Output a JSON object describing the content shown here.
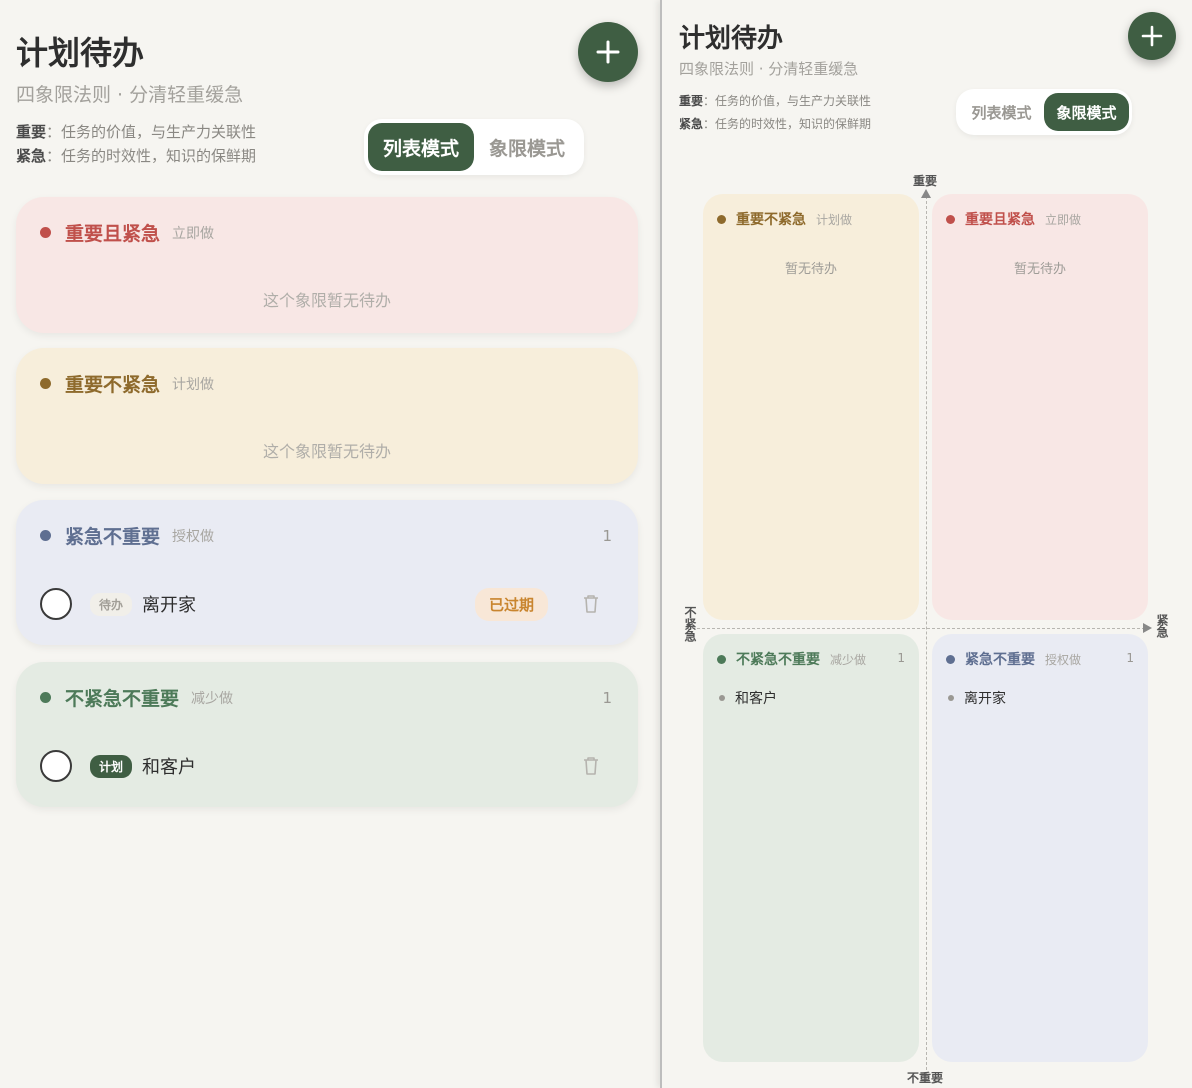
{
  "left": {
    "title": "计划待办",
    "subtitle": "四象限法则 · 分清轻重缓急",
    "defs": [
      {
        "term": "重要",
        "desc": "：任务的价值，与生产力关联性"
      },
      {
        "term": "紧急",
        "desc": "：任务的时效性，知识的保鲜期"
      }
    ],
    "toggle": [
      "列表模式",
      "象限模式"
    ],
    "active_mode": "列表模式",
    "quadrants": [
      {
        "name": "重要且紧急",
        "sub": "立即做",
        "color": "#c0504b",
        "bg": "#f8e7e5",
        "empty_text": "这个象限暂无待办",
        "count": "",
        "tasks": []
      },
      {
        "name": "重要不紧急",
        "sub": "计划做",
        "color": "#8e6a2c",
        "bg": "#f7eedb",
        "empty_text": "这个象限暂无待办",
        "count": "",
        "tasks": []
      },
      {
        "name": "紧急不重要",
        "sub": "授权做",
        "color": "#5f6f91",
        "bg": "#e9ebf3",
        "count": "1",
        "tasks": [
          {
            "tag": "待办",
            "text": "离开家",
            "overdue": "已过期"
          }
        ]
      },
      {
        "name": "不紧急不重要",
        "sub": "减少做",
        "color": "#4d7a59",
        "bg": "#e4ebe3",
        "count": "1",
        "tasks": [
          {
            "tag": "计划",
            "text": "和客户"
          }
        ]
      }
    ]
  },
  "right": {
    "title": "计划待办",
    "subtitle": "四象限法则 · 分清轻重缓急",
    "defs": [
      {
        "term": "重要",
        "desc": "：任务的价值，与生产力关联性"
      },
      {
        "term": "紧急",
        "desc": "：任务的时效性，知识的保鲜期"
      }
    ],
    "toggle": [
      "列表模式",
      "象限模式"
    ],
    "active_mode": "象限模式",
    "axis": {
      "top": "重要",
      "bottom": "不重要",
      "left": "不紧急",
      "right": "紧急"
    },
    "quadrants": [
      {
        "name": "重要不紧急",
        "sub": "计划做",
        "color": "#8e6a2c",
        "bg": "#f7eedb",
        "empty_text": "暂无待办",
        "count": "",
        "items": []
      },
      {
        "name": "重要且紧急",
        "sub": "立即做",
        "color": "#c0504b",
        "bg": "#f8e7e5",
        "empty_text": "暂无待办",
        "count": "",
        "items": []
      },
      {
        "name": "不紧急不重要",
        "sub": "减少做",
        "color": "#4d7a59",
        "bg": "#e4ebe3",
        "count": "1",
        "items": [
          "和客户"
        ]
      },
      {
        "name": "紧急不重要",
        "sub": "授权做",
        "color": "#5f6f91",
        "bg": "#e9ebf3",
        "count": "1",
        "items": [
          "离开家"
        ]
      }
    ]
  },
  "icons": {
    "add": "plus-icon",
    "delete": "trash-icon",
    "arrow_up": "arrow-up-icon",
    "arrow_right": "arrow-right-icon"
  }
}
